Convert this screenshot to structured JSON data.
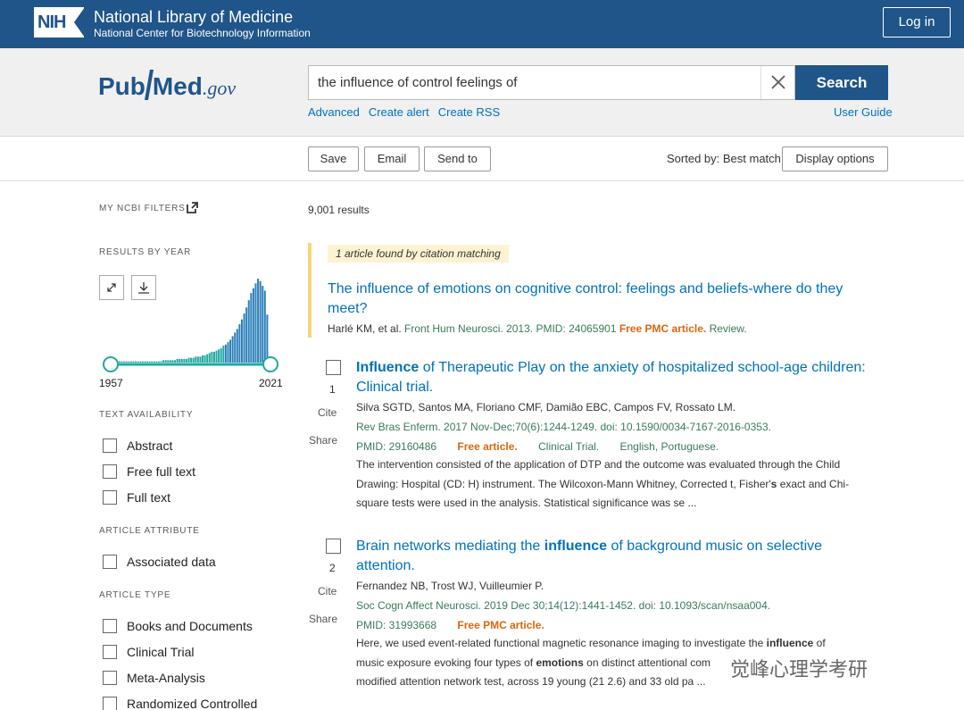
{
  "header": {
    "nih_logo": "NIH",
    "org_title": "National Library of Medicine",
    "org_subtitle": "National Center for Biotechnology Information",
    "login": "Log in"
  },
  "search": {
    "logo_pub": "Pub",
    "logo_med": "Med",
    "logo_gov": ".gov",
    "query": "the influence of control feelings of",
    "search_button": "Search",
    "links": [
      "Advanced",
      "Create alert",
      "Create RSS"
    ],
    "user_guide": "User Guide"
  },
  "actions": {
    "save": "Save",
    "email": "Email",
    "send_to": "Send to",
    "sorted_by": "Sorted by: Best match",
    "display_options": "Display options"
  },
  "sidebar": {
    "my_filters": "MY NCBI FILTERS",
    "results_by_year": "RESULTS BY YEAR",
    "year_start": "1957",
    "year_end": "2021",
    "text_availability": "TEXT AVAILABILITY",
    "text_options": [
      "Abstract",
      "Free full text",
      "Full text"
    ],
    "article_attribute": "ARTICLE ATTRIBUTE",
    "attribute_options": [
      "Associated data"
    ],
    "article_type": "ARTICLE TYPE",
    "type_options": [
      "Books and Documents",
      "Clinical Trial",
      "Meta-Analysis",
      "Randomized Controlled"
    ]
  },
  "histogram": {
    "color": "#20a8a0",
    "counts": [
      1,
      1,
      1,
      1,
      1,
      1,
      1,
      1,
      1,
      1,
      1,
      1,
      1,
      1,
      1,
      1,
      1,
      1,
      1,
      2,
      2,
      2,
      2,
      2,
      2,
      3,
      3,
      3,
      3,
      3,
      4,
      4,
      4,
      5,
      5,
      5,
      6,
      6,
      7,
      8,
      9,
      9,
      10,
      11,
      12,
      14,
      15,
      17,
      19,
      22,
      25,
      28,
      32,
      36,
      41,
      46,
      52,
      58,
      62,
      66,
      70,
      68,
      64,
      60,
      40
    ]
  },
  "results": {
    "count": "9,001 results",
    "citation_badge": "1 article found by citation matching",
    "featured": {
      "title": "The influence of emotions on cognitive control: feelings and beliefs-where do they meet?",
      "authors": "Harlé KM, et al.",
      "journal": "Front Hum Neurosci. 2013. PMID: 24065901",
      "free": "Free PMC article.",
      "type": "Review."
    },
    "items": [
      {
        "num": "1",
        "title_bold": "Influence",
        "title_rest": "of Therapeutic Play on the anxiety of hospitalized school-age children: Clinical trial.",
        "authors": "Silva SGTD, Santos MA, Floriano CMF, Damião EBC, Campos FV, Rossato LM.",
        "journal": "Rev Bras Enferm. 2017 Nov-Dec;70(6):1244-1249. doi: 10.1590/0034-7167-2016-0353.",
        "pmid": "PMID: 29160486",
        "free": "Free article.",
        "type": "Clinical Trial.",
        "lang": "English, Portuguese.",
        "snippet_1": "The intervention consisted of the application of DTP and the outcome was evaluated through the Child",
        "snippet_2a": "Drawing: Hospital (CD: H) instrument. The Wilcoxon-Mann Whitney, Corrected t, Fisher'",
        "snippet_2b": "s",
        "snippet_2c": "exact and Chi-",
        "snippet_3": "square tests were used in the analysis. Statistical significance was se ..."
      },
      {
        "num": "2",
        "title_a": "Brain networks mediating the",
        "title_bold": "influence",
        "title_b": "of background music on selective attention.",
        "authors": "Fernandez NB, Trost WJ, Vuilleumier P.",
        "journal": "Soc Cogn Affect Neurosci. 2019 Dec 30;14(12):1441-1452. doi: 10.1093/scan/nsaa004.",
        "pmid": "PMID: 31993668",
        "free": "Free PMC article.",
        "snippet_1a": "Here, we used event-related functional magnetic resonance imaging to investigate the",
        "snippet_1b": "influence",
        "snippet_1c": "of",
        "snippet_2a": "music exposure evoking four types of",
        "snippet_2b": "emotions",
        "snippet_2c": "on distinct attentional com",
        "snippet_3": "modified attention network test, across 19 young (21 2.6) and 33 old pa ..."
      }
    ],
    "cite": "Cite",
    "share": "Share"
  },
  "watermark": "觉峰心理学考研"
}
